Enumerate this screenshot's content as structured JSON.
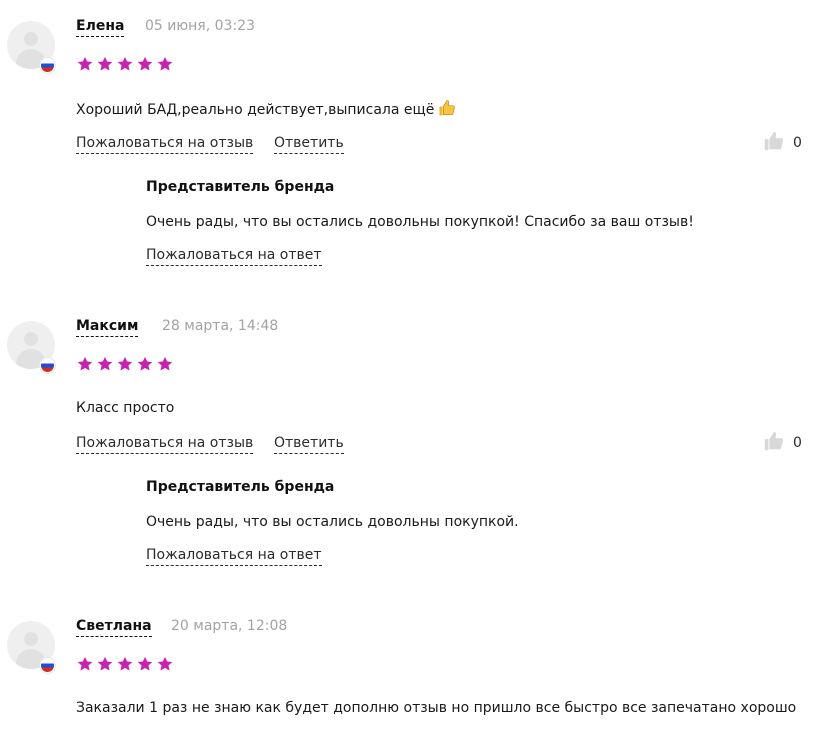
{
  "colors": {
    "star": "#c723b3",
    "date": "#a3a3a3",
    "text": "#1a1a1a",
    "avatar_bg": "#efefef",
    "thumbs_icon": "#d8d8d8"
  },
  "icons": {
    "star": "star-icon",
    "thumbs_up": "thumbs-up-icon",
    "avatar": "user-avatar-icon",
    "flag": "russia-flag-icon",
    "emoji": "thumbs-up-emoji"
  },
  "reviews": [
    {
      "author": "Елена",
      "date": "05 июня, 03:23",
      "rating": 5,
      "text": "Хороший БАД,реально действует,выписала ещё",
      "has_emoji": true,
      "report_label": "Пожаловаться на отзыв",
      "reply_label": "Ответить",
      "likes": "0",
      "brand_reply": {
        "title": "Представитель бренда",
        "text": "Очень рады, что вы остались довольны покупкой! Спасибо за ваш отзыв!",
        "report_label": "Пожаловаться на ответ"
      }
    },
    {
      "author": "Максим",
      "date": "28 марта, 14:48",
      "rating": 5,
      "text": "Класс просто",
      "has_emoji": false,
      "report_label": "Пожаловаться на отзыв",
      "reply_label": "Ответить",
      "likes": "0",
      "brand_reply": {
        "title": "Представитель бренда",
        "text": "Очень рады, что вы остались довольны покупкой.",
        "report_label": "Пожаловаться на ответ"
      }
    },
    {
      "author": "Светлана",
      "date": "20 марта, 12:08",
      "rating": 5,
      "text": "Заказали 1 раз не знаю как будет дополню отзыв но пришло все быстро все запечатано хорошо",
      "has_emoji": false
    }
  ]
}
